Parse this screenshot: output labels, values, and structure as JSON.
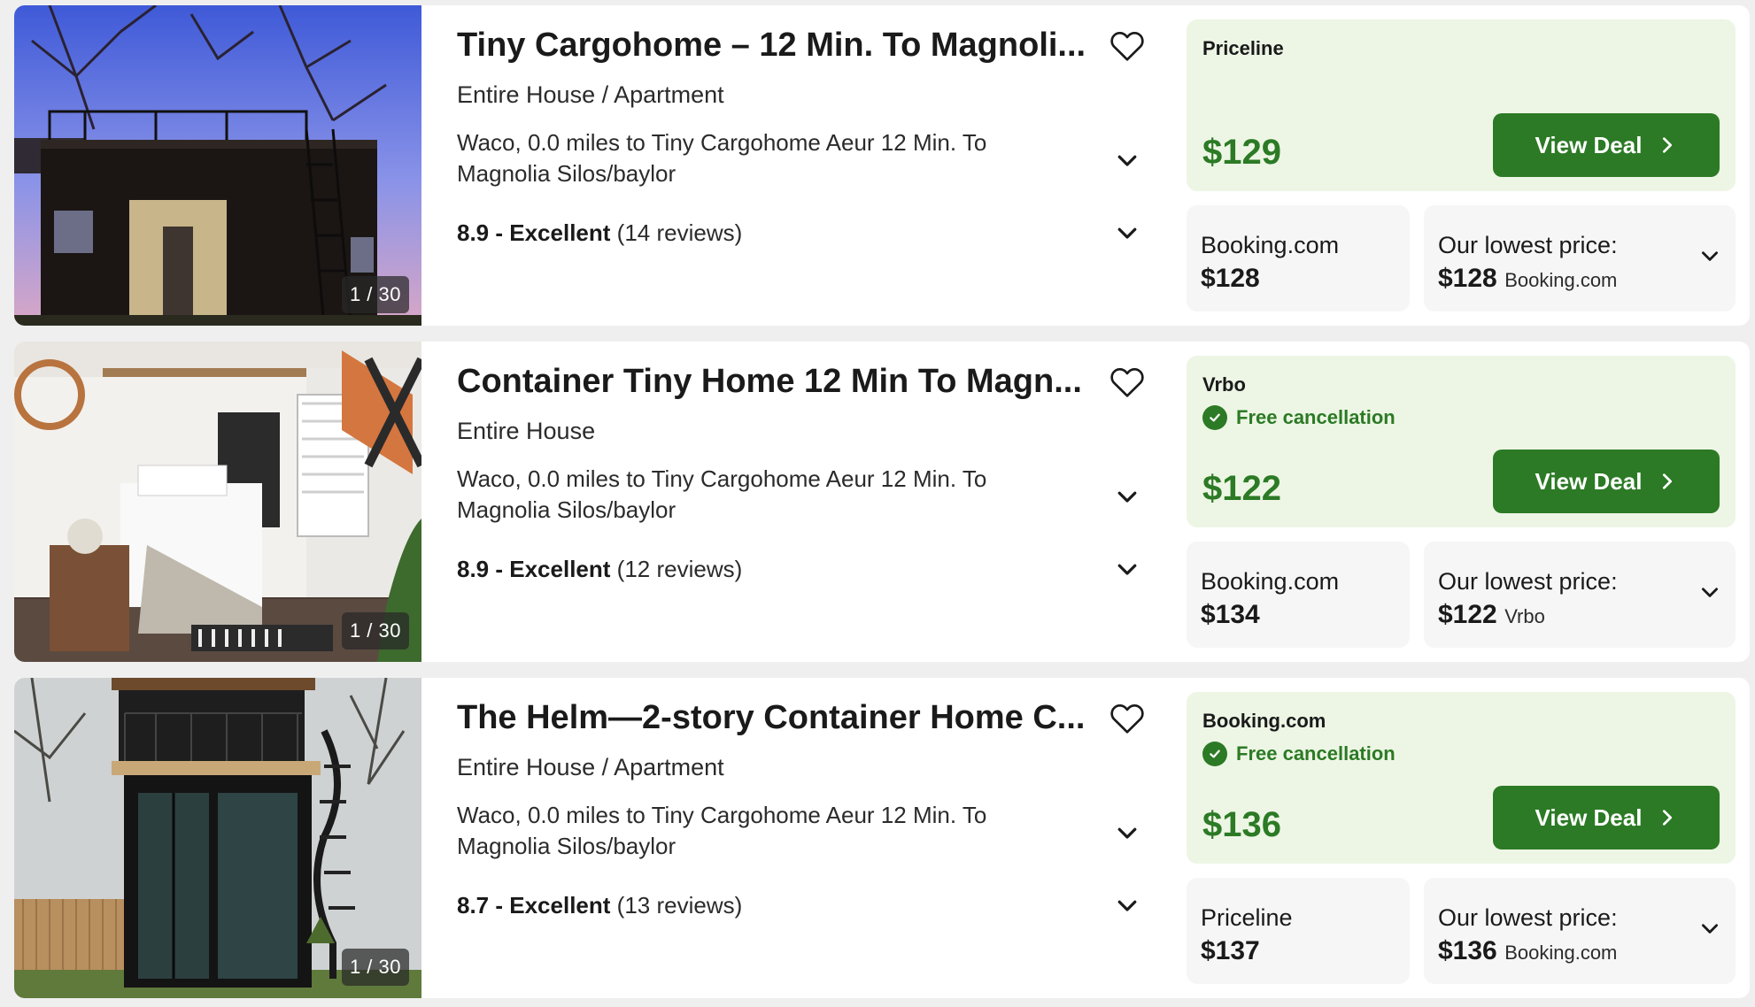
{
  "listings": [
    {
      "title": "Tiny Cargohome – 12 Min. To Magnoli...",
      "type": "Entire House / Apartment",
      "location": "Waco, 0.0 miles to Tiny Cargohome Aeur 12 Min. To Magnolia Silos/baylor",
      "rating_score": "8.9 - Excellent",
      "rating_reviews": "(14 reviews)",
      "photo_counter": "1 / 30",
      "deal_provider": "Priceline",
      "free_cancellation": "",
      "deal_price": "$129",
      "view_deal_label": "View Deal",
      "alt_provider": "Booking.com",
      "alt_price": "$128",
      "lowest_label": "Our lowest price:",
      "lowest_price": "$128",
      "lowest_provider": "Booking.com"
    },
    {
      "title": "Container Tiny Home 12 Min To Magn...",
      "type": "Entire House",
      "location": "Waco, 0.0 miles to Tiny Cargohome Aeur 12 Min. To Magnolia Silos/baylor",
      "rating_score": "8.9 - Excellent",
      "rating_reviews": "(12 reviews)",
      "photo_counter": "1 / 30",
      "deal_provider": "Vrbo",
      "free_cancellation": "Free cancellation",
      "deal_price": "$122",
      "view_deal_label": "View Deal",
      "alt_provider": "Booking.com",
      "alt_price": "$134",
      "lowest_label": "Our lowest price:",
      "lowest_price": "$122",
      "lowest_provider": "Vrbo"
    },
    {
      "title": "The Helm—2-story Container Home C...",
      "type": "Entire House / Apartment",
      "location": "Waco, 0.0 miles to Tiny Cargohome Aeur 12 Min. To Magnolia Silos/baylor",
      "rating_score": "8.7 - Excellent",
      "rating_reviews": "(13 reviews)",
      "photo_counter": "1 / 30",
      "deal_provider": "Booking.com",
      "free_cancellation": "Free cancellation",
      "deal_price": "$136",
      "view_deal_label": "View Deal",
      "alt_provider": "Priceline",
      "alt_price": "$137",
      "lowest_label": "Our lowest price:",
      "lowest_price": "$136",
      "lowest_provider": "Booking.com"
    }
  ],
  "colors": {
    "accent_green": "#2c7a25",
    "deal_bg": "#edf6e5",
    "page_bg": "#efefef"
  },
  "icons": {
    "favorite": "heart-outline-icon",
    "expand": "chevron-down-icon",
    "next": "chevron-right-icon",
    "check": "check-circle-icon"
  }
}
